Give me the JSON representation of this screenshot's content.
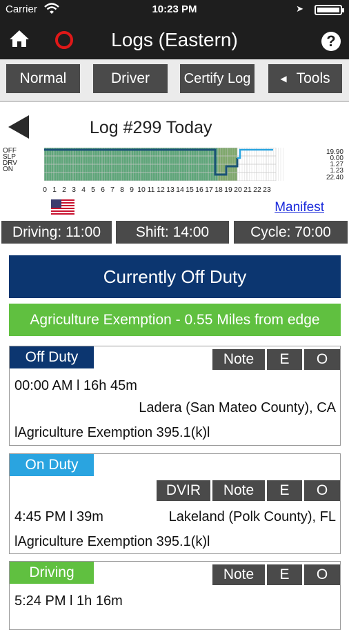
{
  "statusbar": {
    "carrier": "Carrier",
    "time": "10:23 PM",
    "wifi_icon": "wifi-icon",
    "location_icon": "location-arrow-icon",
    "battery_icon": "battery-icon"
  },
  "navbar": {
    "title": "Logs (Eastern)",
    "home_icon": "home-icon",
    "record_icon": "record-circle-icon",
    "help_label": "?"
  },
  "toolbar": {
    "normal": "Normal",
    "driver": "Driver",
    "certify": "Certify Log",
    "tools": "Tools",
    "tools_icon": "◀"
  },
  "log": {
    "title": "Log #299 Today",
    "rows": [
      "OFF",
      "SLP",
      "DRV",
      "ON"
    ],
    "totals": [
      "19.90",
      "0.00",
      "1.27",
      "1.23",
      "22.40"
    ],
    "hours": [
      "0",
      "1",
      "2",
      "3",
      "4",
      "5",
      "6",
      "7",
      "8",
      "9",
      "10",
      "11",
      "12",
      "13",
      "14",
      "15",
      "16",
      "17",
      "18",
      "19",
      "20",
      "21",
      "22",
      "23"
    ],
    "manifest": "Manifest",
    "flag_icon": "us-flag-icon",
    "colors": {
      "grid_fill": "#5fa67a",
      "line": "#1a5276",
      "current": "#2aa4e0"
    }
  },
  "counters": {
    "driving": "Driving: 11:00",
    "shift": "Shift: 14:00",
    "cycle": "Cycle: 70:00"
  },
  "status_banner": "Currently Off Duty",
  "exempt_banner": "Agriculture Exemption - 0.55 Miles from edge",
  "events": [
    {
      "tag": "Off Duty",
      "tag_color": "#0c3670",
      "actions": [
        "Note",
        "E",
        "O"
      ],
      "time": "00:00 AM l 16h 45m",
      "location": "Ladera (San Mateo County), CA",
      "note": "lAgriculture Exemption 395.1(k)l"
    },
    {
      "tag": "On Duty",
      "tag_color": "#2aa4e0",
      "actions": [
        "DVIR",
        "Note",
        "E",
        "O"
      ],
      "time": "4:45 PM l 39m",
      "location": "Lakeland (Polk County), FL",
      "note": "lAgriculture Exemption 395.1(k)l"
    },
    {
      "tag": "Driving",
      "tag_color": "#60c040",
      "actions": [
        "Note",
        "E",
        "O"
      ],
      "time": "5:24 PM l 1h 16m"
    }
  ]
}
